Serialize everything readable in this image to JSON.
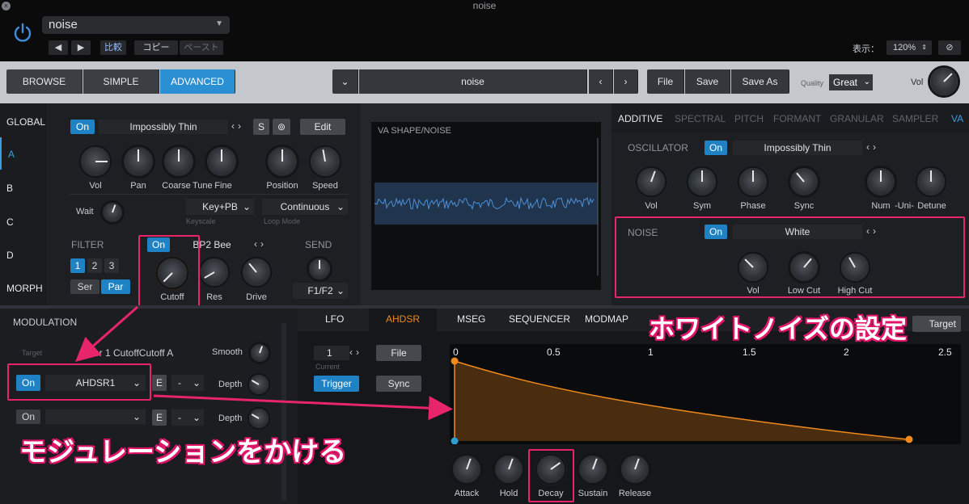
{
  "window": {
    "title": "noise"
  },
  "header": {
    "preset_name": "noise",
    "compare": "比較",
    "copy": "コピー",
    "paste": "ペースト",
    "view_label": "表示：",
    "zoom": "120%"
  },
  "toolbar": {
    "browse": "BROWSE",
    "simple": "SIMPLE",
    "advanced": "ADVANCED",
    "preset": "noise",
    "file": "File",
    "save": "Save",
    "save_as": "Save As",
    "quality_label": "Quality",
    "quality_value": "Great",
    "vol_label": "Vol"
  },
  "sidebar": {
    "items": [
      "GLOBAL",
      "A",
      "B",
      "C",
      "D",
      "MORPH"
    ]
  },
  "osc_a": {
    "on": "On",
    "wave": "Impossibly Thin",
    "s": "S",
    "edit": "Edit",
    "knobs": [
      "Vol",
      "Pan",
      "Coarse",
      "Tune",
      "Fine",
      "Position",
      "Speed"
    ],
    "wait": "Wait",
    "keyscale_value": "Key+PB",
    "keyscale_label": "Keyscale",
    "loop_value": "Continuous",
    "loop_label": "Loop Mode",
    "filter_label": "FILTER",
    "filter_nums": [
      "1",
      "2",
      "3"
    ],
    "ser": "Ser",
    "par": "Par",
    "filter_on": "On",
    "filter_type": "BP2 Bee",
    "cutoff": "Cutoff",
    "res": "Res",
    "drive": "Drive",
    "send_label": "SEND",
    "send_value": "F1/F2"
  },
  "display": {
    "title": "VA SHAPE/NOISE"
  },
  "right_panel": {
    "tabs": [
      "ADDITIVE",
      "SPECTRAL",
      "PITCH",
      "FORMANT",
      "GRANULAR",
      "SAMPLER",
      "VA"
    ],
    "osc_label": "OSCILLATOR",
    "osc_on": "On",
    "osc_wave": "Impossibly Thin",
    "osc_knobs": [
      "Vol",
      "Sym",
      "Phase",
      "Sync",
      "Num",
      "-Uni-",
      "Detune"
    ],
    "noise_label": "NOISE",
    "noise_on": "On",
    "noise_type": "White",
    "noise_knobs": [
      "Vol",
      "Low Cut",
      "High Cut"
    ]
  },
  "modulation": {
    "title": "MODULATION",
    "target_label": "Target",
    "target_value": "Filter 1 CutoffCutoff A",
    "smooth": "Smooth",
    "row1": {
      "on": "On",
      "source": "AHDSR1",
      "e": "E",
      "dash": "-",
      "depth": "Depth"
    },
    "row2": {
      "on": "On",
      "e": "E",
      "dash": "-",
      "depth": "Depth"
    }
  },
  "mod_tabs": [
    "LFO",
    "AHDSR",
    "MSEG",
    "SEQUENCER",
    "MODMAP"
  ],
  "ahdsr": {
    "index": "1",
    "current": "Current",
    "file": "File",
    "trigger": "Trigger",
    "sync": "Sync",
    "target_btn": "Target",
    "axis_ticks": [
      "0",
      "0.5",
      "1",
      "1.5",
      "2",
      "2.5"
    ],
    "knobs": [
      "Attack",
      "Hold",
      "Decay",
      "Sustain",
      "Release"
    ]
  },
  "annotations": {
    "white_noise": "ホワイトノイズの設定",
    "modulation": "モジュレーションをかける"
  },
  "colors": {
    "accent": "#2b8fd4",
    "envelope": "#f08a1c",
    "annotation": "#e8246a"
  }
}
